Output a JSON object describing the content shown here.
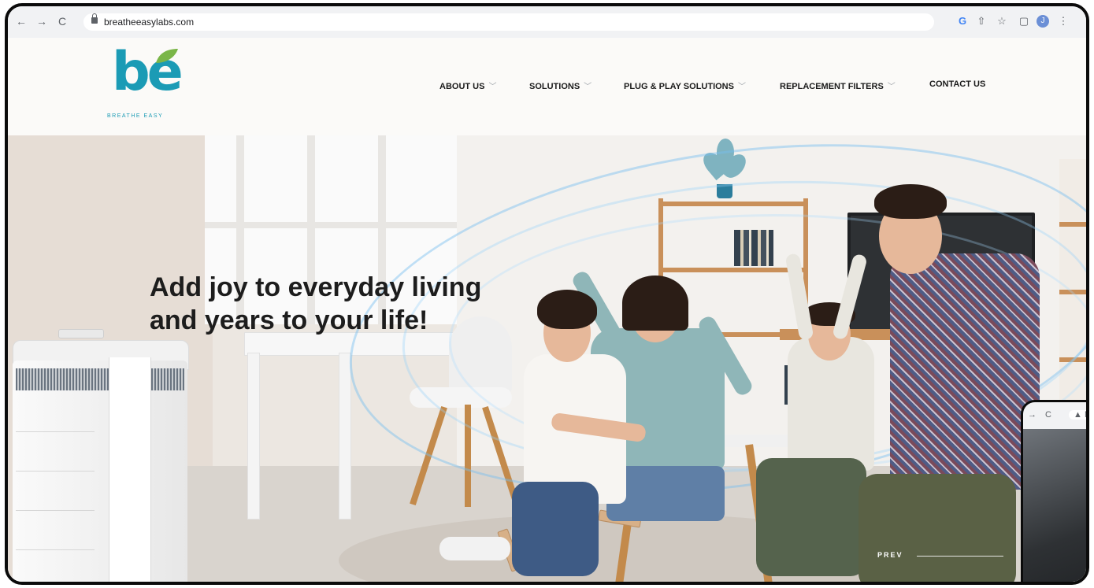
{
  "browser": {
    "url": "breatheeasylabs.com",
    "back_icon": "←",
    "forward_icon": "→",
    "reload_icon": "C",
    "toolbar_icons": [
      "G",
      "⇧",
      "☆",
      "▢",
      "J",
      "⋮"
    ]
  },
  "brand": {
    "logo_text": "be",
    "tagline": "BREATHE EASY",
    "accent_color": "#1b9bb5",
    "leaf_color": "#7ab648"
  },
  "nav": {
    "items": [
      {
        "label": "ABOUT US",
        "has_dropdown": true
      },
      {
        "label": "SOLUTIONS",
        "has_dropdown": true
      },
      {
        "label": "PLUG & PLAY SOLUTIONS",
        "has_dropdown": true
      },
      {
        "label": "REPLACEMENT FILTERS",
        "has_dropdown": true
      },
      {
        "label": "CONTACT US",
        "has_dropdown": false
      }
    ],
    "chevron": "﹀"
  },
  "hero": {
    "headline_line1": "Add joy to everyday living",
    "headline_line2": "and years to your life!",
    "prev_label": "PREV"
  },
  "inset": {
    "arrow": "→",
    "reload": "C",
    "badge": "▲ N"
  }
}
